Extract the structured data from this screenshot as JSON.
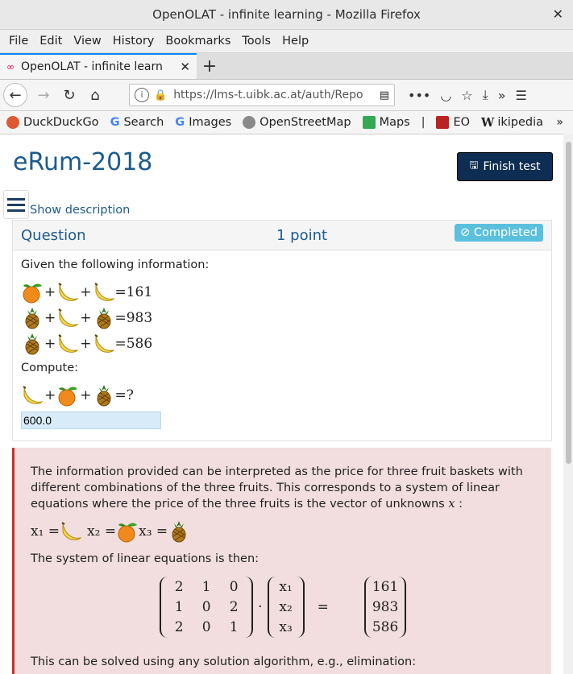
{
  "window": {
    "title": "OpenOLAT - infinite learning - Mozilla Firefox"
  },
  "menu": [
    "File",
    "Edit",
    "View",
    "History",
    "Bookmarks",
    "Tools",
    "Help"
  ],
  "tab": {
    "title": "OpenOLAT - infinite learn"
  },
  "address": {
    "url": "https://lms-t.uibk.ac.at/auth/Repo"
  },
  "bookmarks": [
    "DuckDuckGo",
    "Search",
    "Images",
    "OpenStreetMap",
    "Maps",
    "|",
    "EO",
    "ikipedia"
  ],
  "page": {
    "title": "eRum-2018",
    "finish_label": "Finish test",
    "show_description": "Show description"
  },
  "question": {
    "label": "Question",
    "points": "1 point",
    "status": "Completed",
    "intro": "Given the following information:",
    "rows": [
      {
        "items": [
          "orange",
          "banana",
          "banana"
        ],
        "result": "=161"
      },
      {
        "items": [
          "pineapple",
          "banana",
          "pineapple"
        ],
        "result": "=983"
      },
      {
        "items": [
          "pineapple",
          "banana",
          "banana"
        ],
        "result": "=586"
      }
    ],
    "compute_label": "Compute:",
    "compute_row": {
      "items": [
        "banana",
        "orange",
        "pineapple"
      ],
      "result": "=?"
    },
    "answer_value": "600.0"
  },
  "solution": {
    "text1": "The information provided can be interpreted as the price for three fruit baskets with different combinations of the three fruits. This corresponds to a system of linear equations where the price of the three fruits is the vector of unknowns",
    "text1_var": "x",
    "text1_end": " :",
    "vars": [
      "x₁ =",
      "x₂ =",
      "x₃ ="
    ],
    "text2": "The system of linear equations is then:",
    "matrix": [
      [
        "2",
        "1",
        "0"
      ],
      [
        "1",
        "0",
        "2"
      ],
      [
        "2",
        "0",
        "1"
      ]
    ],
    "xvec": [
      "x₁",
      "x₂",
      "x₃"
    ],
    "rhs": [
      "161",
      "983",
      "586"
    ],
    "dot": "·",
    "equals": "=",
    "text3": "This can be solved using any solution algorithm, e.g., elimination:"
  }
}
